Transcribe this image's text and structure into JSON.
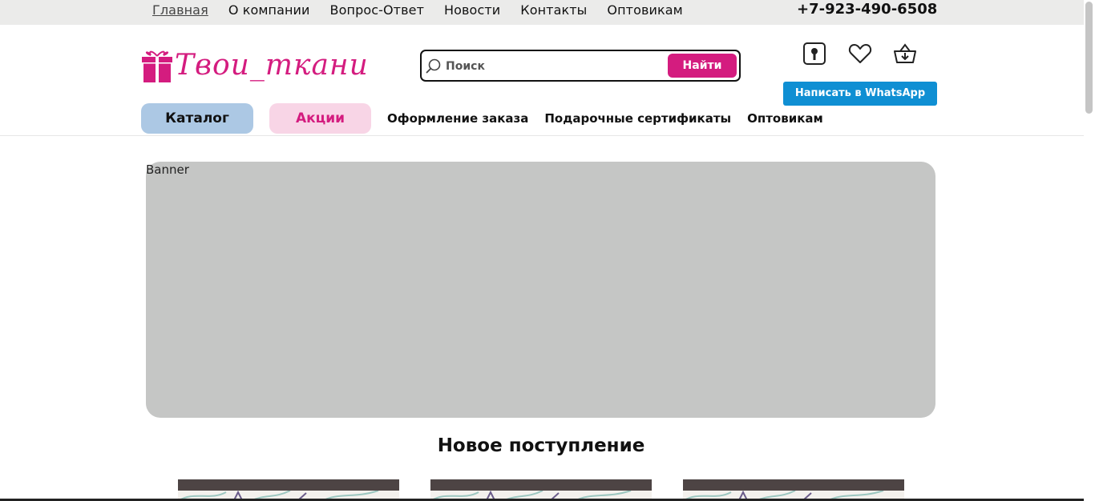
{
  "topbar": {
    "links": [
      {
        "label": "Главная",
        "active": true
      },
      {
        "label": "О компании"
      },
      {
        "label": "Вопрос-Ответ"
      },
      {
        "label": "Новости"
      },
      {
        "label": "Контакты"
      },
      {
        "label": "Оптовикам"
      }
    ],
    "phone": "+7-923-490-6508"
  },
  "header": {
    "logo_text": "Твои_ткани",
    "search": {
      "placeholder": "Поиск",
      "button_label": "Найти"
    },
    "icons": [
      "login-icon",
      "heart-icon",
      "basket-icon"
    ],
    "whatsapp_label": "Написать в WhatsApp"
  },
  "mainnav": {
    "catalog_label": "Каталог",
    "promo_label": "Акции",
    "links": [
      "Оформление заказа",
      "Подарочные сертификаты",
      "Оптовикам"
    ]
  },
  "banner": {
    "label": "Banner"
  },
  "new_arrivals": {
    "title": "Новое поступление"
  },
  "colors": {
    "brand_pink": "#d41c7f",
    "catalog_blue": "#acc8e4",
    "promo_pink": "#f8d5e6",
    "whatsapp_blue": "#0f8fd3",
    "topbar_gray": "#ebebea",
    "banner_gray": "#c5c6c5"
  }
}
